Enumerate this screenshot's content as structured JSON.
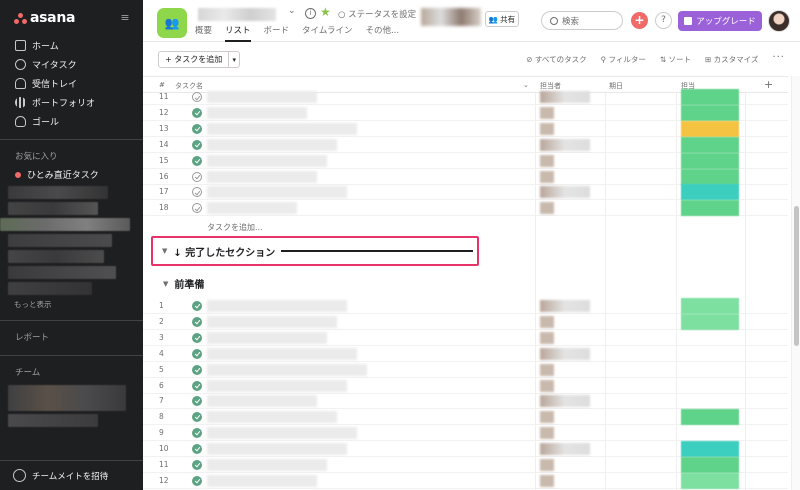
{
  "sidebar": {
    "logo": "asana",
    "nav": [
      {
        "label": "ホーム",
        "icon": "home-icon"
      },
      {
        "label": "マイタスク",
        "icon": "check-circle-icon"
      },
      {
        "label": "受信トレイ",
        "icon": "bell-icon"
      },
      {
        "label": "ポートフォリオ",
        "icon": "bar-chart-icon"
      },
      {
        "label": "ゴール",
        "icon": "person-icon"
      }
    ],
    "favorites_label": "お気に入り",
    "favorites_item": "ひとみ直近タスク",
    "more_link": "もっと表示",
    "reports_label": "レポート",
    "team_label": "チーム",
    "invite_label": "チームメイトを招待"
  },
  "header": {
    "status_label": "○ ステータスを設定",
    "share_label": "共有",
    "tabs": [
      "概要",
      "リスト",
      "ボード",
      "タイムライン",
      "その他..."
    ],
    "active_tab": "リスト",
    "search_placeholder": "検索",
    "upgrade_label": "アップグレード",
    "help_label": "?"
  },
  "toolbar": {
    "add_task_label": "タスクを追加",
    "filter_all_tasks": "すべてのタスク",
    "filter_label": "フィルター",
    "sort_label": "ソート",
    "customize_label": "カスタマイズ",
    "more_label": "···"
  },
  "table": {
    "columns": {
      "num": "#",
      "task_name": "タスク名",
      "assignee": "担当者",
      "due_date": "期日",
      "owner": "担当",
      "add_col": "+"
    },
    "section1_rows": [
      {
        "num": "11",
        "done": false,
        "tag": "#5fd38a"
      },
      {
        "num": "12",
        "done": true,
        "tag": "#5fd38a"
      },
      {
        "num": "13",
        "done": true,
        "tag": "#f5c342"
      },
      {
        "num": "14",
        "done": true,
        "tag": "#5fd38a"
      },
      {
        "num": "15",
        "done": true,
        "tag": "#5fd38a"
      },
      {
        "num": "16",
        "done": false,
        "tag": "#5fd38a"
      },
      {
        "num": "17",
        "done": false,
        "tag": "#3ccfc0"
      },
      {
        "num": "18",
        "done": false,
        "tag": "#5fd38a"
      }
    ],
    "add_task_in_section": "タスクを追加...",
    "completed_section_label": "↓ 完了したセクション",
    "section2_label": "前準備",
    "section2_rows": [
      {
        "num": "1",
        "done": true,
        "tag": "#7ee0a0"
      },
      {
        "num": "2",
        "done": true,
        "tag": "#7ee0a0"
      },
      {
        "num": "3",
        "done": true,
        "tag": ""
      },
      {
        "num": "4",
        "done": true,
        "tag": ""
      },
      {
        "num": "5",
        "done": true,
        "tag": ""
      },
      {
        "num": "6",
        "done": true,
        "tag": ""
      },
      {
        "num": "7",
        "done": true,
        "tag": ""
      },
      {
        "num": "8",
        "done": true,
        "tag": "#5fd38a"
      },
      {
        "num": "9",
        "done": true,
        "tag": ""
      },
      {
        "num": "10",
        "done": true,
        "tag": "#3ccfc0"
      },
      {
        "num": "11",
        "done": true,
        "tag": "#5fd38a"
      },
      {
        "num": "12",
        "done": true,
        "tag": "#7ee0a0"
      }
    ]
  }
}
